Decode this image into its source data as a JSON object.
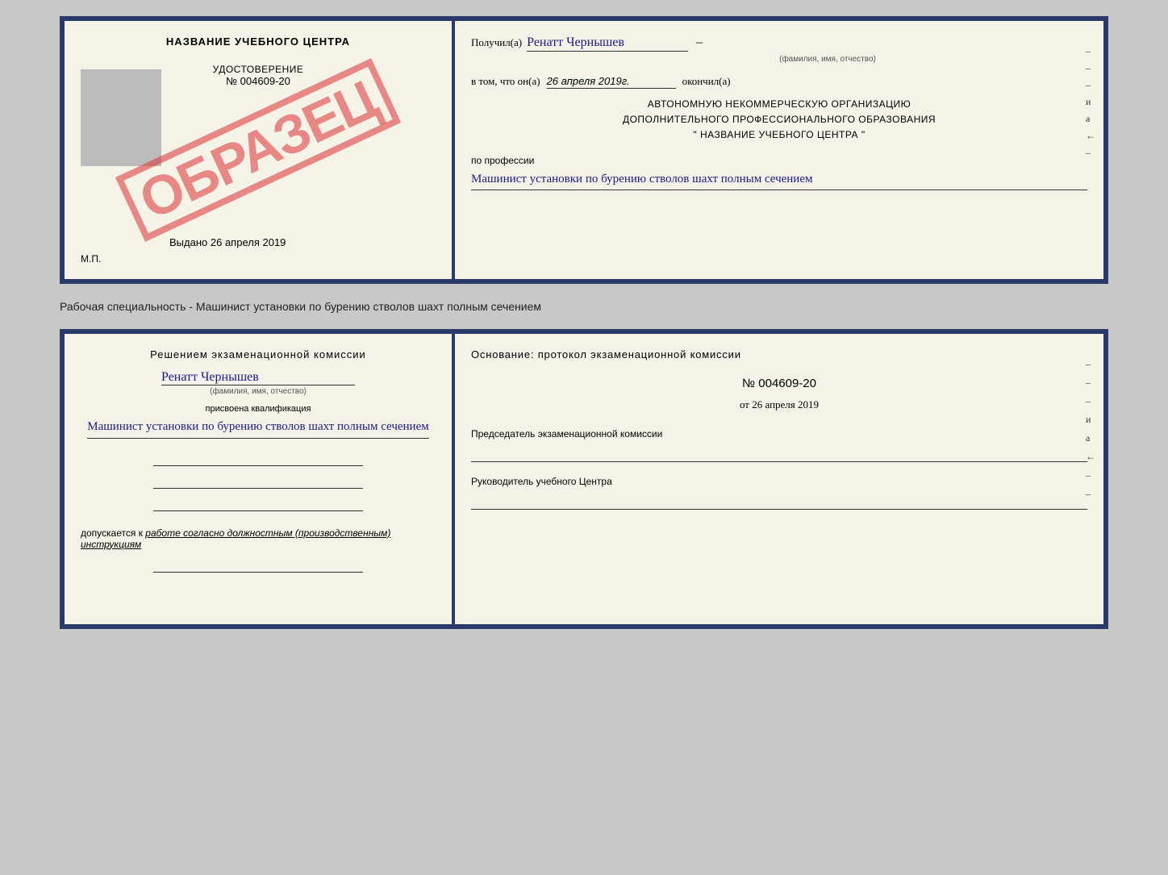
{
  "top_left": {
    "title": "НАЗВАНИЕ УЧЕБНОГО ЦЕНТРА",
    "obrazec": "ОБРАЗЕЦ",
    "udostoverenie_label": "УДОСТОВЕРЕНИЕ",
    "number": "№ 004609-20",
    "vibrano_label": "Выдано",
    "vibrano_date": "26 апреля 2019",
    "mp": "М.П."
  },
  "top_right": {
    "poluchil_label": "Получил(а)",
    "poluchil_name": "Ренатт Чернышев",
    "fio_hint": "(фамилия, имя, отчество)",
    "vtom_label": "в том, что он(а)",
    "vtom_date": "26 апреля 2019г.",
    "okonchil_label": "окончил(а)",
    "org_line1": "АВТОНОМНУЮ НЕКОММЕРЧЕСКУЮ ОРГАНИЗАЦИЮ",
    "org_line2": "ДОПОЛНИТЕЛЬНОГО ПРОФЕССИОНАЛЬНОГО ОБРАЗОВАНИЯ",
    "org_line3": "\" НАЗВАНИЕ УЧЕБНОГО ЦЕНТРА \"",
    "po_professii_label": "по профессии",
    "profession": "Машинист установки по бурению стволов шахт полным сечением",
    "dashes": [
      "-",
      "-",
      "-",
      "и",
      "а",
      "←",
      "-"
    ]
  },
  "specialty_label": "Рабочая специальность - Машинист установки по бурению стволов шахт полным сечением",
  "bottom_left": {
    "resheniyem": "Решением  экзаменационной  комиссии",
    "person_name": "Ренатт Чернышев",
    "fio_hint": "(фамилия, имя, отчество)",
    "prisvoena_label": "присвоена квалификация",
    "kvalifia": "Машинист установки по бурению стволов шахт полным сечением",
    "dopusk_prefix": "допускается к",
    "dopusk_text": "работе согласно должностным (производственным) инструкциям"
  },
  "bottom_right": {
    "osnovanie": "Основание: протокол экзаменационной  комиссии",
    "protocol_number": "№  004609-20",
    "ot_label": "от",
    "ot_date": "26 апреля 2019",
    "predsedatel_label": "Председатель экзаменационной комиссии",
    "rukovoditell_label": "Руководитель учебного Центра",
    "dashes": [
      "-",
      "-",
      "-",
      "и",
      "а",
      "←",
      "-",
      "-"
    ]
  }
}
